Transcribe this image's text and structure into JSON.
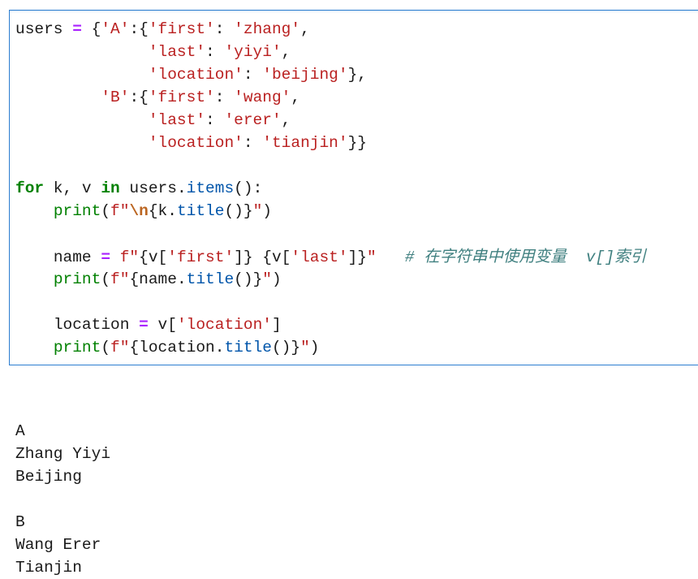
{
  "notebook": {
    "code_cell": {
      "lines": [
        [
          [
            "var",
            "users"
          ],
          [
            "sp",
            " "
          ],
          [
            "op",
            "="
          ],
          [
            "sp",
            " "
          ],
          [
            "p",
            "{"
          ],
          [
            "str",
            "'A'"
          ],
          [
            "p",
            ":{"
          ],
          [
            "str",
            "'first'"
          ],
          [
            "p",
            ": "
          ],
          [
            "str",
            "'zhang'"
          ],
          [
            "p",
            ","
          ]
        ],
        [
          [
            "sp",
            "              "
          ],
          [
            "str",
            "'last'"
          ],
          [
            "p",
            ": "
          ],
          [
            "str",
            "'yiyi'"
          ],
          [
            "p",
            ","
          ]
        ],
        [
          [
            "sp",
            "              "
          ],
          [
            "str",
            "'location'"
          ],
          [
            "p",
            ": "
          ],
          [
            "str",
            "'beijing'"
          ],
          [
            "p",
            "},"
          ]
        ],
        [
          [
            "sp",
            "         "
          ],
          [
            "str",
            "'B'"
          ],
          [
            "p",
            ":{"
          ],
          [
            "str",
            "'first'"
          ],
          [
            "p",
            ": "
          ],
          [
            "str",
            "'wang'"
          ],
          [
            "p",
            ","
          ]
        ],
        [
          [
            "sp",
            "              "
          ],
          [
            "str",
            "'last'"
          ],
          [
            "p",
            ": "
          ],
          [
            "str",
            "'erer'"
          ],
          [
            "p",
            ","
          ]
        ],
        [
          [
            "sp",
            "              "
          ],
          [
            "str",
            "'location'"
          ],
          [
            "p",
            ": "
          ],
          [
            "str",
            "'tianjin'"
          ],
          [
            "p",
            "}}"
          ]
        ],
        [],
        [
          [
            "kw",
            "for"
          ],
          [
            "p",
            " k, v "
          ],
          [
            "kw",
            "in"
          ],
          [
            "p",
            " users."
          ],
          [
            "attr",
            "items"
          ],
          [
            "p",
            "():"
          ]
        ],
        [
          [
            "sp",
            "    "
          ],
          [
            "bi",
            "print"
          ],
          [
            "p",
            "("
          ],
          [
            "str",
            "f\""
          ],
          [
            "esc",
            "\\n"
          ],
          [
            "p",
            "{k."
          ],
          [
            "attr",
            "title"
          ],
          [
            "p",
            "()}"
          ],
          [
            "str",
            "\""
          ],
          [
            "p",
            ")"
          ]
        ],
        [],
        [
          [
            "sp",
            "    "
          ],
          [
            "p",
            "name "
          ],
          [
            "op",
            "="
          ],
          [
            "p",
            " "
          ],
          [
            "str",
            "f\""
          ],
          [
            "p",
            "{v["
          ],
          [
            "str",
            "'first'"
          ],
          [
            "p",
            "]} {v["
          ],
          [
            "str",
            "'last'"
          ],
          [
            "p",
            "]}"
          ],
          [
            "str",
            "\""
          ],
          [
            "sp",
            "   "
          ],
          [
            "cm",
            "# "
          ],
          [
            "cmcjk",
            "在字符串中使用变量  "
          ],
          [
            "cm",
            " v[]"
          ],
          [
            "cmcjk",
            "索引"
          ]
        ],
        [
          [
            "sp",
            "    "
          ],
          [
            "bi",
            "print"
          ],
          [
            "p",
            "("
          ],
          [
            "str",
            "f\""
          ],
          [
            "p",
            "{name."
          ],
          [
            "attr",
            "title"
          ],
          [
            "p",
            "()}"
          ],
          [
            "str",
            "\""
          ],
          [
            "p",
            ")"
          ]
        ],
        [],
        [
          [
            "sp",
            "    "
          ],
          [
            "p",
            "location "
          ],
          [
            "op",
            "="
          ],
          [
            "p",
            " v["
          ],
          [
            "str",
            "'location'"
          ],
          [
            "p",
            "]"
          ]
        ],
        [
          [
            "sp",
            "    "
          ],
          [
            "bi",
            "print"
          ],
          [
            "p",
            "("
          ],
          [
            "str",
            "f\""
          ],
          [
            "p",
            "{location."
          ],
          [
            "attr",
            "title"
          ],
          [
            "p",
            "()}"
          ],
          [
            "str",
            "\""
          ],
          [
            "p",
            ")"
          ]
        ]
      ]
    },
    "output_cell": {
      "lines": [
        "",
        "A",
        "Zhang Yiyi",
        "Beijing",
        "",
        "B",
        "Wang Erer",
        "Tianjin"
      ]
    },
    "colors": {
      "cell_border": "#2f7fd1",
      "keyword": "#008000",
      "builtin": "#008000",
      "operator": "#aa22ff",
      "string": "#ba2121",
      "attribute": "#0055aa",
      "comment": "#408080"
    }
  }
}
